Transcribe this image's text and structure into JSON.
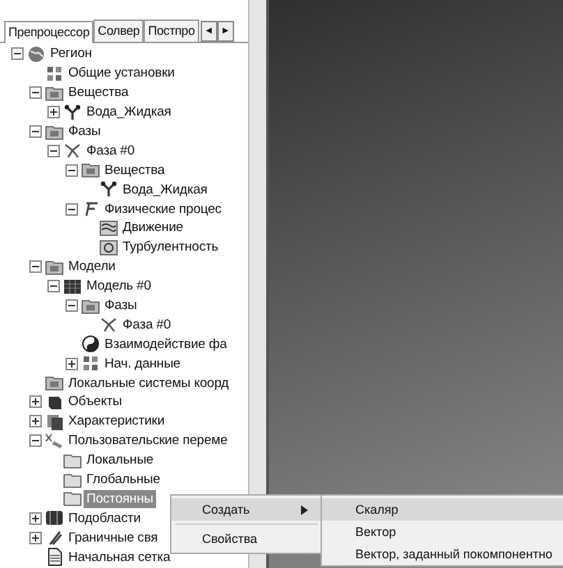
{
  "tabs": [
    {
      "label": "Препроцессор",
      "selected": true
    },
    {
      "label": "Солвер",
      "selected": false
    },
    {
      "label": "Постпро",
      "selected": false
    }
  ],
  "tab_scroll": [
    "◄",
    "►"
  ],
  "tree": [
    {
      "label": "Регион",
      "kind": "region",
      "expanded": true,
      "selected": false,
      "children": [
        {
          "label": "Общие установки",
          "kind": "settings",
          "selected": false
        },
        {
          "label": "Вещества",
          "kind": "folder",
          "expanded": true,
          "selected": false,
          "children": [
            {
              "label": "Вода_Жидкая",
              "kind": "substance",
              "expanded": false,
              "selected": false
            }
          ]
        },
        {
          "label": "Фазы",
          "kind": "folder",
          "expanded": true,
          "selected": false,
          "children": [
            {
              "label": "Фаза #0",
              "kind": "phase",
              "expanded": true,
              "selected": false,
              "children": [
                {
                  "label": "Вещества",
                  "kind": "folder",
                  "expanded": true,
                  "selected": false,
                  "children": [
                    {
                      "label": "Вода_Жидкая",
                      "kind": "substance",
                      "selected": false
                    }
                  ]
                },
                {
                  "label": "Физические процес",
                  "kind": "physics",
                  "expanded": true,
                  "selected": false,
                  "children": [
                    {
                      "label": "Движение",
                      "kind": "motion",
                      "selected": false
                    },
                    {
                      "label": "Турбулентность",
                      "kind": "turbulence",
                      "selected": false
                    }
                  ]
                }
              ]
            }
          ]
        },
        {
          "label": "Модели",
          "kind": "folder",
          "expanded": true,
          "selected": false,
          "children": [
            {
              "label": "Модель #0",
              "kind": "model",
              "expanded": true,
              "selected": false,
              "children": [
                {
                  "label": "Фазы",
                  "kind": "folder",
                  "expanded": true,
                  "selected": false,
                  "children": [
                    {
                      "label": "Фаза #0",
                      "kind": "phase",
                      "selected": false
                    }
                  ]
                },
                {
                  "label": "Взаимодействие фа",
                  "kind": "interaction",
                  "selected": false
                },
                {
                  "label": "Нач. данные",
                  "kind": "settings",
                  "expanded": false,
                  "selected": false
                }
              ]
            }
          ]
        },
        {
          "label": "Локальные системы коорд",
          "kind": "folder",
          "selected": false
        },
        {
          "label": "Объекты",
          "kind": "objects",
          "expanded": false,
          "selected": false
        },
        {
          "label": "Характеристики",
          "kind": "characteristics",
          "expanded": false,
          "selected": false
        },
        {
          "label": "Пользовательские переме",
          "kind": "variables",
          "expanded": true,
          "selected": false,
          "children": [
            {
              "label": "Локальные",
              "kind": "plainfolder",
              "selected": false
            },
            {
              "label": "Глобальные",
              "kind": "plainfolder",
              "selected": false
            },
            {
              "label": "Постоянны",
              "kind": "plainfolder",
              "selected": true
            }
          ]
        },
        {
          "label": "Подобласти",
          "kind": "subdomain",
          "expanded": false,
          "selected": false
        },
        {
          "label": "Граничные свя",
          "kind": "boundary",
          "expanded": false,
          "selected": false
        },
        {
          "label": "Начальная сетка",
          "kind": "mesh",
          "selected": false
        }
      ]
    }
  ],
  "context_menu": {
    "items": [
      {
        "label": "Создать",
        "submenu": true,
        "selected": true
      },
      {
        "label": "Свойства",
        "submenu": false,
        "selected": false
      }
    ]
  },
  "submenu": {
    "items": [
      {
        "label": "Скаляр",
        "selected": true
      },
      {
        "label": "Вектор",
        "selected": false
      },
      {
        "label": "Вектор, заданный покомпонентно",
        "selected": false
      }
    ]
  }
}
